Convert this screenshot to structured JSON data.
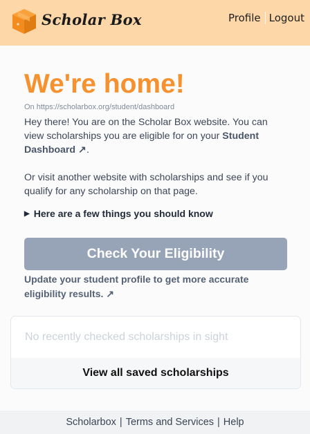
{
  "header": {
    "brand": "Scholar Box",
    "nav": {
      "profile": "Profile",
      "logout": "Logout"
    }
  },
  "colors": {
    "header_bg": "#fdd7a8",
    "accent": "#f5922f",
    "button": "#97a3b6"
  },
  "main": {
    "headline": "We're home!",
    "url_text": "On https://scholarbox.org/student/dashboard",
    "intro_text": "Hey there! You are on the Scholar Box website. You can view scholarships you are eligible for on your ",
    "dashboard_link": "Student Dashboard ↗",
    "intro_end": ".",
    "other_text": "Or visit another website with scholarships and see if you qualify for any scholarship on that page.",
    "details_label": "Here are a few things you should know",
    "cta_label": "Check Your Eligibility",
    "update_link": "Update your student profile to get more accurate eligibility results. ↗"
  },
  "saved": {
    "empty_text": "No recently checked scholarships in sight",
    "view_all_label": "View all saved scholarships"
  },
  "footer": {
    "scholarbox": "Scholarbox",
    "terms": "Terms and Services",
    "help": "Help",
    "separator": "|"
  }
}
